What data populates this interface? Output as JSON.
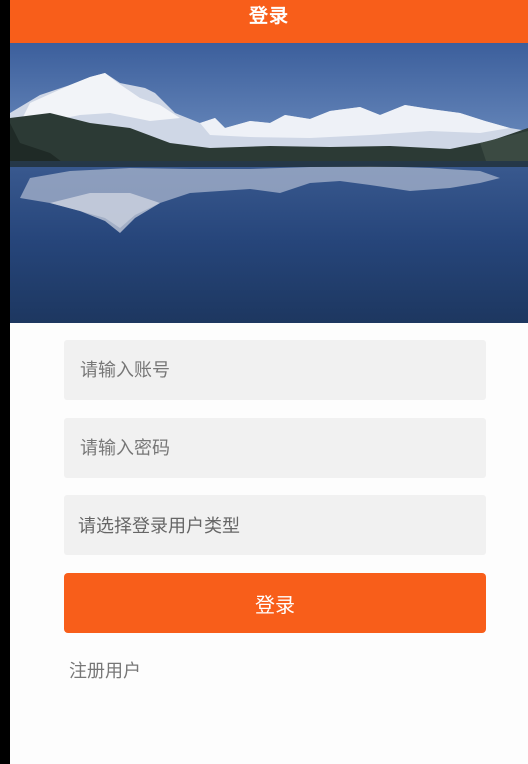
{
  "header": {
    "title": "登录"
  },
  "banner": {
    "description": "mountain-lake-landscape"
  },
  "form": {
    "account_placeholder": "请输入账号",
    "password_placeholder": "请输入密码",
    "user_type_placeholder": "请选择登录用户类型",
    "login_label": "登录",
    "register_label": "注册用户"
  },
  "colors": {
    "accent": "#f85e1a",
    "field_bg": "#f1f1f1"
  }
}
